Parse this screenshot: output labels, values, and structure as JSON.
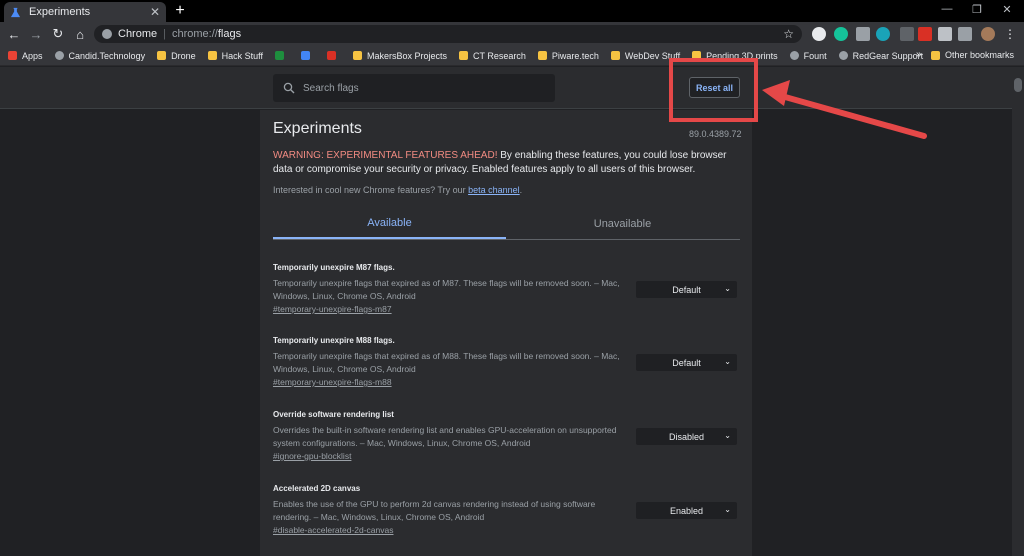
{
  "tab": {
    "title": "Experiments"
  },
  "omnibox": {
    "site": "Chrome",
    "url_scheme": "chrome://",
    "url_path": "flags"
  },
  "bookmarks": [
    {
      "label": "Apps",
      "icon": "apps-icon"
    },
    {
      "label": "Candid.Technology",
      "icon": "site-icon"
    },
    {
      "label": "Drone",
      "icon": "folder-icon"
    },
    {
      "label": "Hack Stuff",
      "icon": "folder-icon"
    },
    {
      "label": "",
      "icon": "drive-icon"
    },
    {
      "label": "",
      "icon": "docs-icon"
    },
    {
      "label": "",
      "icon": "gmail-icon"
    },
    {
      "label": "MakersBox Projects",
      "icon": "folder-icon"
    },
    {
      "label": "CT Research",
      "icon": "folder-icon"
    },
    {
      "label": "Piware.tech",
      "icon": "folder-icon"
    },
    {
      "label": "WebDev Stuff",
      "icon": "folder-icon"
    },
    {
      "label": "Pending 3D prints",
      "icon": "folder-icon"
    },
    {
      "label": "Fount",
      "icon": "site-icon"
    },
    {
      "label": "RedGear Support",
      "icon": "site-icon"
    }
  ],
  "other_bookmarks": "Other bookmarks",
  "search": {
    "placeholder": "Search flags"
  },
  "reset_label": "Reset all",
  "page": {
    "title": "Experiments",
    "version": "89.0.4389.72",
    "warning_strong": "WARNING: EXPERIMENTAL FEATURES AHEAD!",
    "warning_rest": " By enabling these features, you could lose browser data or compromise your security or privacy. Enabled features apply to all users of this browser.",
    "interest_text": "Interested in cool new Chrome features? Try our ",
    "interest_link": "beta channel",
    "interest_end": "."
  },
  "tabs": {
    "available": "Available",
    "unavailable": "Unavailable"
  },
  "flags": [
    {
      "name": "Temporarily unexpire M87 flags.",
      "desc": "Temporarily unexpire flags that expired as of M87. These flags will be removed soon. – Mac, Windows, Linux, Chrome OS, Android",
      "link": "#temporary-unexpire-flags-m87",
      "value": "Default"
    },
    {
      "name": "Temporarily unexpire M88 flags.",
      "desc": "Temporarily unexpire flags that expired as of M88. These flags will be removed soon. – Mac, Windows, Linux, Chrome OS, Android",
      "link": "#temporary-unexpire-flags-m88",
      "value": "Default"
    },
    {
      "name": "Override software rendering list",
      "desc": "Overrides the built-in software rendering list and enables GPU-acceleration on unsupported system configurations. – Mac, Windows, Linux, Chrome OS, Android",
      "link": "#ignore-gpu-blocklist",
      "value": "Disabled"
    },
    {
      "name": "Accelerated 2D canvas",
      "desc": "Enables the use of the GPU to perform 2d canvas rendering instead of using software rendering. – Mac, Windows, Linux, Chrome OS, Android",
      "link": "#disable-accelerated-2d-canvas",
      "value": "Enabled"
    }
  ],
  "colors": {
    "accent": "#8ab4f8",
    "warning": "#f28b82",
    "highlight": "#e54848"
  }
}
